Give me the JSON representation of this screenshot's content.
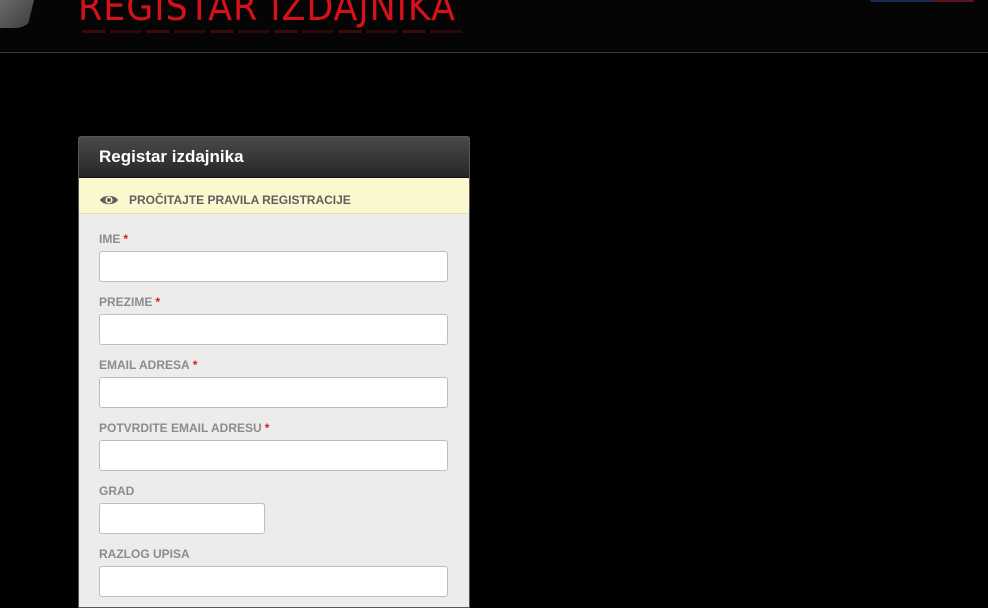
{
  "header": {
    "site_title": "REGISTAR IZDAJNIKA"
  },
  "panel": {
    "title": "Registar izdajnika",
    "notice": {
      "icon": "eye-icon",
      "text": "PROČITAJTE PRAVILA REGISTRACIJE"
    },
    "required_mark": "*",
    "fields": [
      {
        "label": "IME",
        "required": true,
        "value": "",
        "placeholder": ""
      },
      {
        "label": "PREZIME",
        "required": true,
        "value": "",
        "placeholder": ""
      },
      {
        "label": "EMAIL ADRESA",
        "required": true,
        "value": "",
        "placeholder": ""
      },
      {
        "label": "POTVRDITE EMAIL ADRESU",
        "required": true,
        "value": "",
        "placeholder": ""
      },
      {
        "label": "GRAD",
        "required": false,
        "value": "",
        "placeholder": ""
      },
      {
        "label": "RAZLOG UPISA",
        "required": false,
        "value": "",
        "placeholder": ""
      }
    ]
  },
  "colors": {
    "title_red": "#d6111a",
    "required_red": "#cc2222",
    "notice_bg": "#fbf7cf",
    "panel_bg": "#ececec"
  }
}
